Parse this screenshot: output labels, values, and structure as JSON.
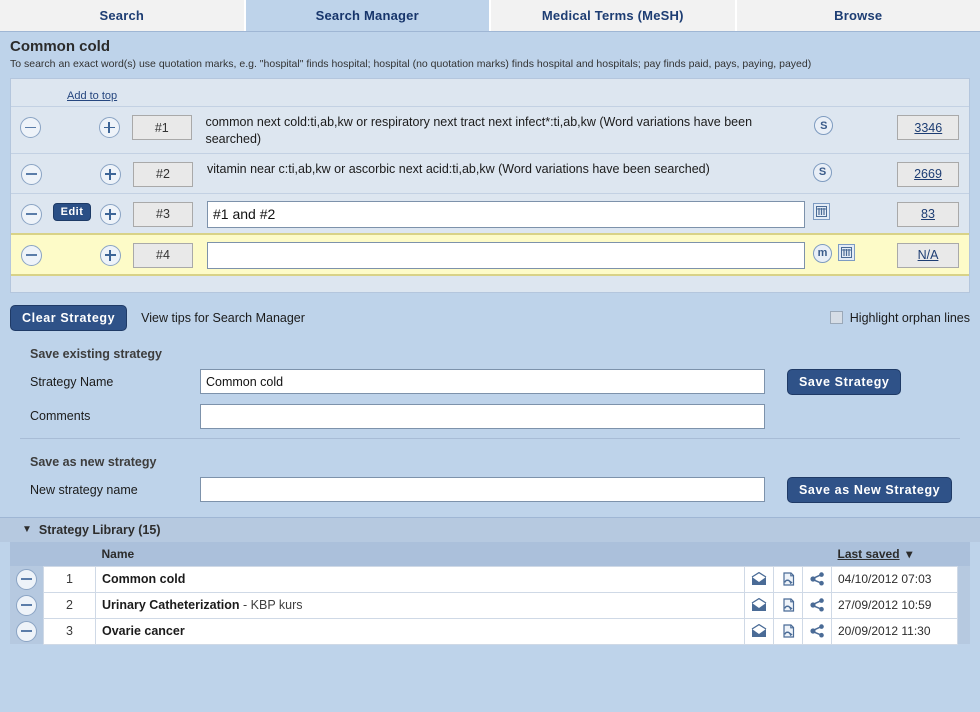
{
  "tabs": [
    {
      "label": "Search",
      "active": false,
      "name": "tab-search"
    },
    {
      "label": "Search Manager",
      "active": true,
      "name": "tab-search-manager"
    },
    {
      "label": "Medical Terms (MeSH)",
      "active": false,
      "name": "tab-medical-terms"
    },
    {
      "label": "Browse",
      "active": false,
      "name": "tab-browse"
    }
  ],
  "header": {
    "title": "Common cold",
    "hint": "To search an exact word(s) use quotation marks, e.g. \"hospital\" finds hospital; hospital (no quotation marks) finds hospital and hospitals; pay finds paid, pays, paying, payed)"
  },
  "search_rows": {
    "add_to_top_label": "Add to top",
    "rows": [
      {
        "number": "#1",
        "query": "common next cold:ti,ab,kw or respiratory next tract next infect*:ti,ab,kw (Word variations have been searched)",
        "editable": false,
        "has_edit_button": false,
        "icons": [
          "s-circle-icon"
        ],
        "count": "3346",
        "highlight": false
      },
      {
        "number": "#2",
        "query": "vitamin near c:ti,ab,kw or ascorbic next acid:ti,ab,kw (Word variations have been searched)",
        "editable": false,
        "has_edit_button": false,
        "icons": [
          "s-circle-icon"
        ],
        "count": "2669",
        "highlight": false
      },
      {
        "number": "#3",
        "query": "#1 and #2",
        "editable": true,
        "has_edit_button": true,
        "edit_label": "Edit",
        "icons": [
          "grid-icon"
        ],
        "count": "83",
        "highlight": false
      },
      {
        "number": "#4",
        "query": "",
        "editable": true,
        "has_edit_button": false,
        "icons": [
          "m-circle-icon",
          "grid-icon"
        ],
        "count": "N/A",
        "highlight": true
      }
    ]
  },
  "controls": {
    "clear_strategy_label": "Clear Strategy",
    "view_tips_label": "View tips for Search Manager",
    "highlight_orphan_label": "Highlight orphan lines",
    "highlight_orphan_checked": false,
    "save_existing_heading": "Save existing strategy",
    "strategy_name_label": "Strategy Name",
    "strategy_name_value": "Common cold",
    "comments_label": "Comments",
    "comments_value": "",
    "save_strategy_label": "Save Strategy",
    "save_as_new_heading": "Save as new strategy",
    "new_strategy_name_label": "New strategy name",
    "new_strategy_name_value": "",
    "save_as_new_label": "Save as New Strategy"
  },
  "library": {
    "title": "Strategy Library (15)",
    "count": 15,
    "columns": {
      "name": "Name",
      "last_saved": "Last saved"
    },
    "sort": {
      "column": "Last saved",
      "direction": "desc"
    },
    "rows": [
      {
        "index": "1",
        "name_bold": "Common cold",
        "name_rest": "",
        "last_saved": "04/10/2012 07:03"
      },
      {
        "index": "2",
        "name_bold": "Urinary Catheterization",
        "name_rest": " - KBP kurs",
        "last_saved": "27/09/2012 10:59"
      },
      {
        "index": "3",
        "name_bold": "Ovarie cancer",
        "name_rest": "",
        "last_saved": "20/09/2012 11:30"
      }
    ],
    "row_icons": [
      "envelope-upload-icon",
      "document-copy-icon",
      "share-icon"
    ]
  },
  "colors": {
    "page_bg": "#bed3ea",
    "panel_bg": "#dde6f0",
    "accent_dark_blue": "#2f5288",
    "highlight_yellow": "#fdfbc8",
    "table_header": "#abc0db"
  }
}
